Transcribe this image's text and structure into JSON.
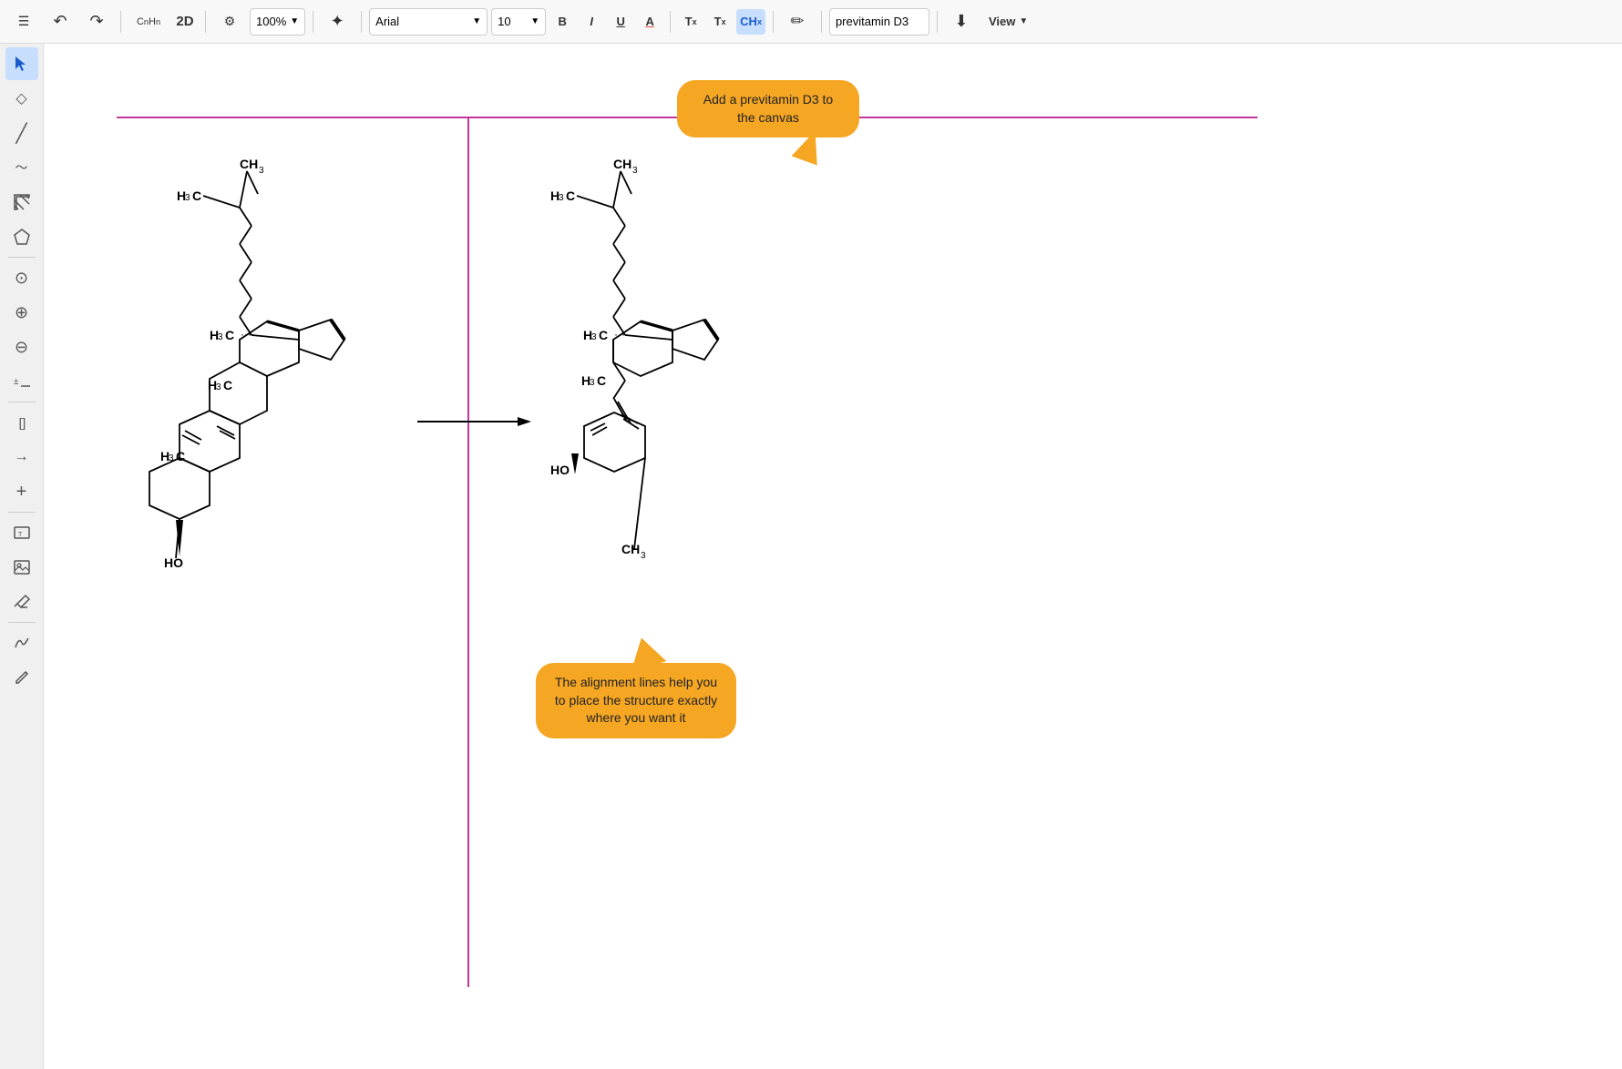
{
  "toolbar": {
    "menu_icon": "☰",
    "undo_icon": "↩",
    "redo_icon": "↪",
    "formula_label": "CₙHₙ",
    "mode_label": "2D",
    "settings_icon": "⚙",
    "zoom_label": "100%",
    "magic_icon": "✦",
    "font_family": "Arial",
    "font_size": "10",
    "bold_label": "B",
    "italic_label": "I",
    "underline_label": "U",
    "color_label": "A",
    "superscript_label": "Tˣ",
    "subscript_label": "Tₓ",
    "chem_label": "CHₓ",
    "eraser_icon": "✏",
    "search_placeholder": "previtamin D3",
    "download_icon": "⬇",
    "view_label": "View"
  },
  "sidebar": {
    "items": [
      {
        "name": "select",
        "icon": "⬆",
        "active": true
      },
      {
        "name": "shape",
        "icon": "◇"
      },
      {
        "name": "line",
        "icon": "/"
      },
      {
        "name": "wave",
        "icon": "〜"
      },
      {
        "name": "hatch",
        "icon": "⋰"
      },
      {
        "name": "pentagon",
        "icon": "⬠"
      },
      {
        "name": "atom",
        "icon": "⊙"
      },
      {
        "name": "zoom-in",
        "icon": "⊕"
      },
      {
        "name": "zoom-out",
        "icon": "⊖"
      },
      {
        "name": "number",
        "icon": "±"
      },
      {
        "name": "bracket",
        "icon": "[ ]"
      },
      {
        "name": "arrow",
        "icon": "→"
      },
      {
        "name": "plus",
        "icon": "+"
      },
      {
        "name": "frame",
        "icon": "⊡"
      },
      {
        "name": "image",
        "icon": "🖼"
      },
      {
        "name": "eraser2",
        "icon": "⬡"
      },
      {
        "name": "freehand",
        "icon": "∿"
      },
      {
        "name": "pencil",
        "icon": "✎"
      }
    ]
  },
  "tooltip1": {
    "text": "Add a previtamin D3 to the canvas"
  },
  "tooltip2": {
    "text": "The alignment lines help you to place the structure exactly where you want it"
  }
}
